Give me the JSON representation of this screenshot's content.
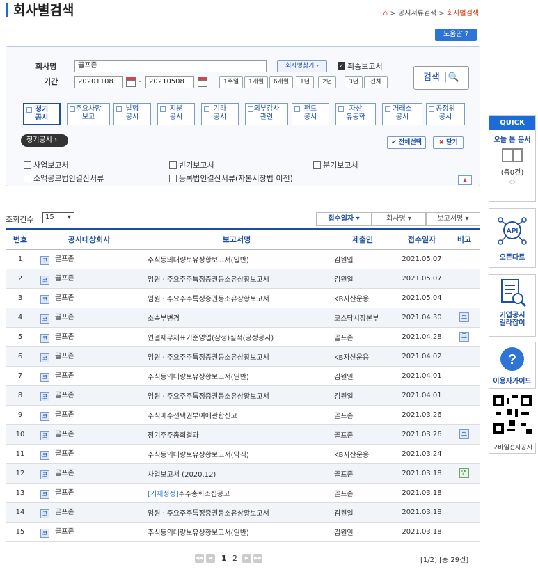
{
  "page": {
    "title": "회사별검색",
    "breadcrumb": [
      "공시서류검색",
      "회사별검색"
    ],
    "help_label": "도움말"
  },
  "search": {
    "company_label": "회사명",
    "company_value": "골프존",
    "find_company_label": "회사명찾기",
    "final_report_label": "최종보고서",
    "final_report_checked": true,
    "period_label": "기간",
    "date_from": "20201108",
    "date_to": "20210508",
    "period_buttons": [
      "1주일",
      "1개월",
      "6개월",
      "1년",
      "2년",
      "3년",
      "전체"
    ],
    "search_button": "검색",
    "categories": [
      [
        "정기",
        "공시"
      ],
      [
        "주요사항",
        "보고"
      ],
      [
        "발행",
        "공시"
      ],
      [
        "지분",
        "공시"
      ],
      [
        "기타",
        "공시"
      ],
      [
        "외부감사",
        "관련"
      ],
      [
        "펀드",
        "공시"
      ],
      [
        "자산",
        "유동화"
      ],
      [
        "거래소",
        "공시"
      ],
      [
        "공정위",
        "공시"
      ]
    ],
    "active_category_tag": "정기공시",
    "select_all": "전체선택",
    "close": "닫기",
    "options": [
      "사업보고서",
      "반기보고서",
      "분기보고서",
      "소액공모법인결산서류",
      "등록법인결산서류(자본시장법 이전)"
    ]
  },
  "list": {
    "count_label": "조회건수",
    "count_value": "15",
    "sort_buttons": [
      "접수일자",
      "회사명",
      "보고서명"
    ],
    "headers": [
      "번호",
      "공시대상회사",
      "보고서명",
      "제출인",
      "접수일자",
      "비고"
    ],
    "market_badge": "코",
    "rows": [
      {
        "no": "1",
        "company": "골프존",
        "report": "주식등의대량보유상황보고서(일반)",
        "prefix": "",
        "submitter": "김원일",
        "date": "2021.05.07",
        "note": ""
      },
      {
        "no": "2",
        "company": "골프존",
        "report": "임원ㆍ주요주주특정증권등소유상황보고서",
        "prefix": "",
        "submitter": "김원일",
        "date": "2021.05.07",
        "note": ""
      },
      {
        "no": "3",
        "company": "골프존",
        "report": "임원ㆍ주요주주특정증권등소유상황보고서",
        "prefix": "",
        "submitter": "KB자산운용",
        "date": "2021.05.04",
        "note": ""
      },
      {
        "no": "4",
        "company": "골프존",
        "report": "소속부변경",
        "prefix": "",
        "submitter": "코스닥시장본부",
        "date": "2021.04.30",
        "note": "코"
      },
      {
        "no": "5",
        "company": "골프존",
        "report": "연결재무제표기준영업(잠정)실적(공정공시)",
        "prefix": "",
        "submitter": "골프존",
        "date": "2021.04.28",
        "note": "코"
      },
      {
        "no": "6",
        "company": "골프존",
        "report": "임원ㆍ주요주주특정증권등소유상황보고서",
        "prefix": "",
        "submitter": "KB자산운용",
        "date": "2021.04.02",
        "note": ""
      },
      {
        "no": "7",
        "company": "골프존",
        "report": "주식등의대량보유상황보고서(일반)",
        "prefix": "",
        "submitter": "김원일",
        "date": "2021.04.01",
        "note": ""
      },
      {
        "no": "8",
        "company": "골프존",
        "report": "임원ㆍ주요주주특정증권등소유상황보고서",
        "prefix": "",
        "submitter": "김원일",
        "date": "2021.04.01",
        "note": ""
      },
      {
        "no": "9",
        "company": "골프존",
        "report": "주식매수선택권부여에관한신고",
        "prefix": "",
        "submitter": "골프존",
        "date": "2021.03.26",
        "note": ""
      },
      {
        "no": "10",
        "company": "골프존",
        "report": "정기주주총회결과",
        "prefix": "",
        "submitter": "골프존",
        "date": "2021.03.26",
        "note": "코"
      },
      {
        "no": "11",
        "company": "골프존",
        "report": "주식등의대량보유상황보고서(약식)",
        "prefix": "",
        "submitter": "KB자산운용",
        "date": "2021.03.24",
        "note": ""
      },
      {
        "no": "12",
        "company": "골프존",
        "report": "사업보고서 (2020.12)",
        "prefix": "",
        "submitter": "골프존",
        "date": "2021.03.18",
        "note": "연"
      },
      {
        "no": "13",
        "company": "골프존",
        "report": "주주총회소집공고",
        "prefix": "[기재정정]",
        "submitter": "골프존",
        "date": "2021.03.18",
        "note": ""
      },
      {
        "no": "14",
        "company": "골프존",
        "report": "임원ㆍ주요주주특정증권등소유상황보고서",
        "prefix": "",
        "submitter": "김원일",
        "date": "2021.03.18",
        "note": ""
      },
      {
        "no": "15",
        "company": "골프존",
        "report": "주식등의대량보유상황보고서(일반)",
        "prefix": "",
        "submitter": "김원일",
        "date": "2021.03.18",
        "note": ""
      }
    ],
    "pages": [
      "1",
      "2"
    ],
    "page_info": "[1/2] [총 29건]"
  },
  "sidebar": {
    "quick": "QUICK",
    "today_docs": "오늘 본 문서",
    "today_count": "(총0건)",
    "opendart": "오픈다트",
    "guide_company": [
      "기업공시",
      "길라잡이"
    ],
    "user_guide": "이용자가이드",
    "mobile": "모바일전자공시"
  },
  "colors": {
    "accent": "#1b6bd9",
    "link": "#1d4ea3",
    "alt_row": "#f1f4f9"
  }
}
